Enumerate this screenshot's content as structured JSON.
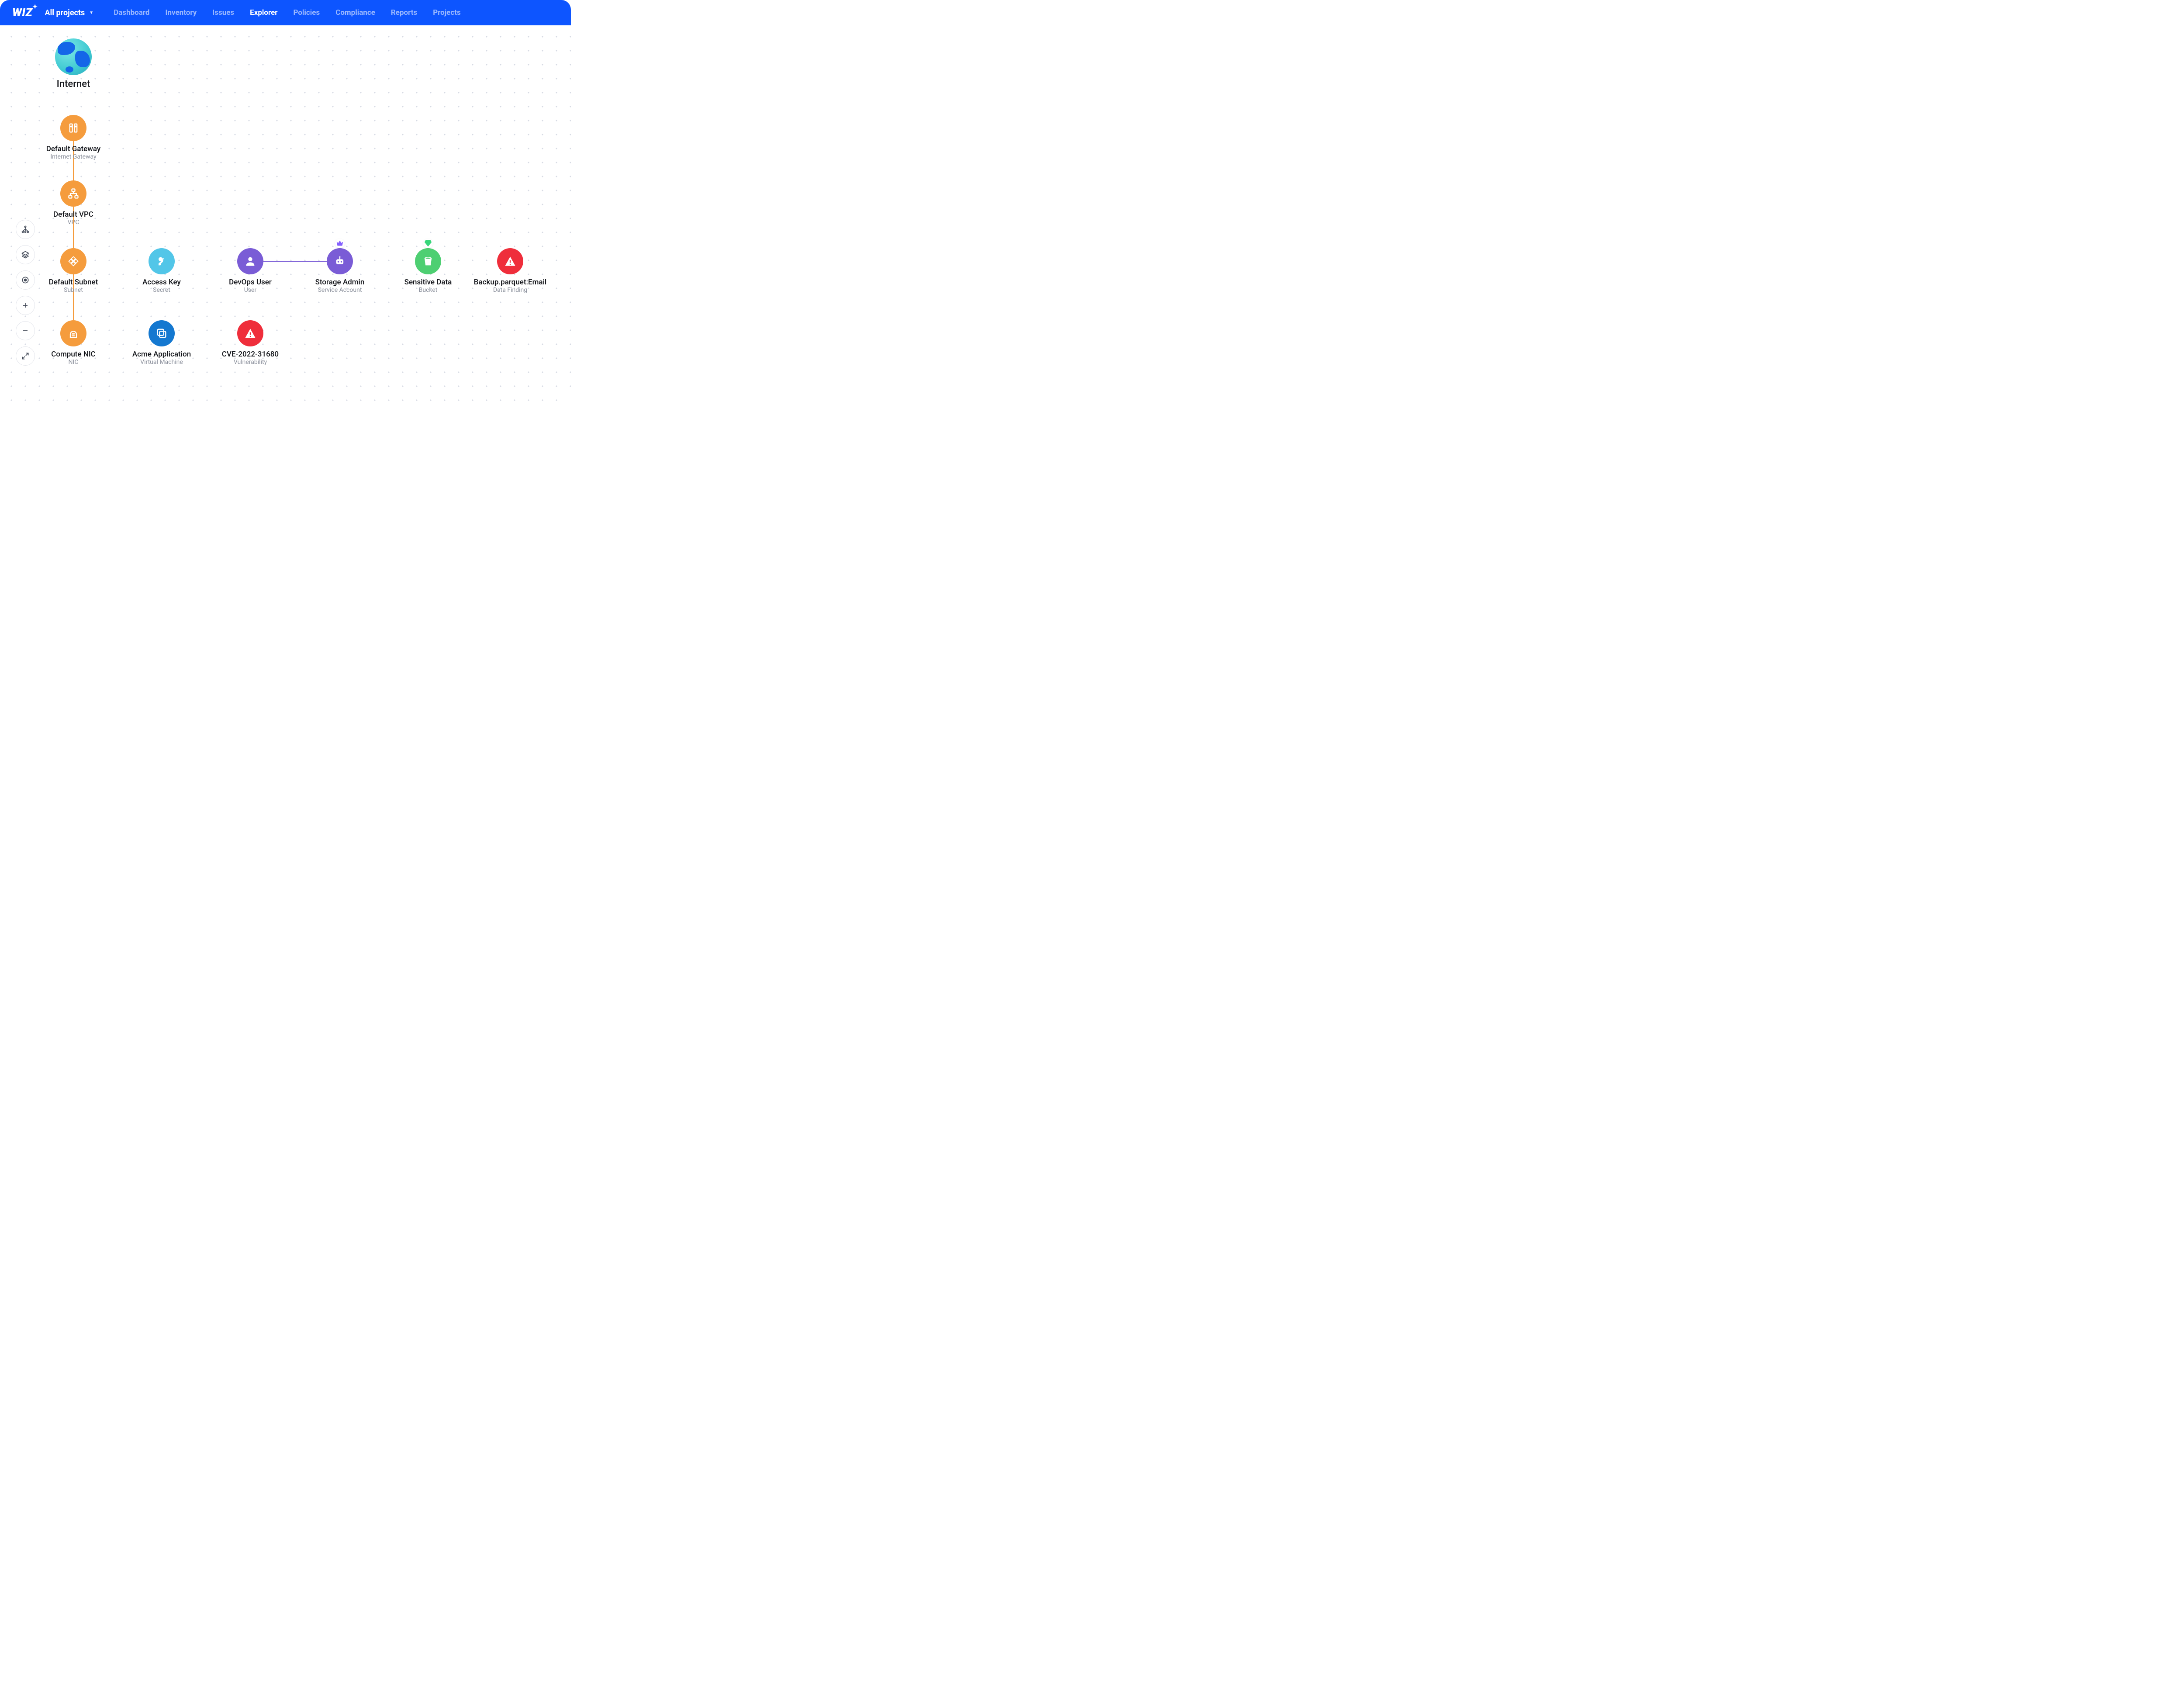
{
  "brand": "WIZ",
  "project_switcher": {
    "label": "All projects"
  },
  "nav": {
    "items": [
      {
        "label": "Dashboard",
        "active": false
      },
      {
        "label": "Inventory",
        "active": false
      },
      {
        "label": "Issues",
        "active": false
      },
      {
        "label": "Explorer",
        "active": true
      },
      {
        "label": "Policies",
        "active": false
      },
      {
        "label": "Compliance",
        "active": false
      },
      {
        "label": "Reports",
        "active": false
      },
      {
        "label": "Projects",
        "active": false
      }
    ]
  },
  "nodes": {
    "internet": {
      "title": "Internet"
    },
    "gateway": {
      "title": "Default Gateway",
      "subtitle": "Internet Gateway"
    },
    "vpc": {
      "title": "Default VPC",
      "subtitle": "VPC"
    },
    "subnet": {
      "title": "Default Subnet",
      "subtitle": "Subnet"
    },
    "nic": {
      "title": "Compute NIC",
      "subtitle": "NIC"
    },
    "access_key": {
      "title": "Access Key",
      "subtitle": "Secret"
    },
    "vm": {
      "title": "Acme Application",
      "subtitle": "Virtual Machine"
    },
    "devops_user": {
      "title": "DevOps User",
      "subtitle": "User"
    },
    "cve": {
      "title": "CVE-2022-31680",
      "subtitle": "Vulnerability"
    },
    "storage_admin": {
      "title": "Storage Admin",
      "subtitle": "Service Account"
    },
    "sensitive_data": {
      "title": "Sensitive Data",
      "subtitle": "Bucket"
    },
    "backup": {
      "title": "Backup.parquet:Email",
      "subtitle": "Data Finding"
    }
  },
  "colors": {
    "orange": "#f59c3d",
    "cyan": "#52c6e8",
    "purple": "#7a5cd6",
    "green": "#4ecf72",
    "red": "#ef2e3b",
    "blue": "#1478d0",
    "badge_purple": "#8560ff",
    "badge_green": "#38d67a"
  }
}
